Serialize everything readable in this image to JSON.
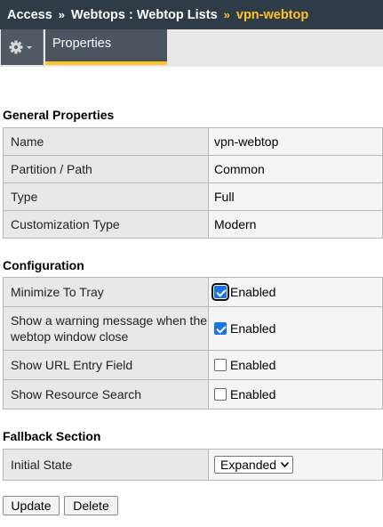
{
  "breadcrumb": {
    "items": [
      "Access",
      "Webtops : Webtop Lists",
      "vpn-webtop"
    ],
    "separator": "»"
  },
  "tabs": {
    "gear_menu": "gear-icon",
    "active_tab": "Properties"
  },
  "general": {
    "title": "General Properties",
    "rows": [
      {
        "label": "Name",
        "value": "vpn-webtop"
      },
      {
        "label": "Partition / Path",
        "value": "Common"
      },
      {
        "label": "Type",
        "value": "Full"
      },
      {
        "label": "Customization Type",
        "value": "Modern"
      }
    ]
  },
  "configuration": {
    "title": "Configuration",
    "rows": [
      {
        "label": "Minimize To Tray",
        "checked": true,
        "value": "Enabled"
      },
      {
        "label": "Show a warning message when the webtop window close",
        "checked": true,
        "value": "Enabled"
      },
      {
        "label": "Show URL Entry Field",
        "checked": false,
        "value": "Enabled"
      },
      {
        "label": "Show Resource Search",
        "checked": false,
        "value": "Enabled"
      }
    ]
  },
  "fallback": {
    "title": "Fallback Section",
    "rows": [
      {
        "label": "Initial State",
        "selected": "Expanded"
      }
    ]
  },
  "actions": {
    "update_label": "Update",
    "delete_label": "Delete"
  },
  "colors": {
    "header_bg": "#2f3c48",
    "accent": "#ffc425",
    "checkbox_on": "#1a73e8"
  }
}
